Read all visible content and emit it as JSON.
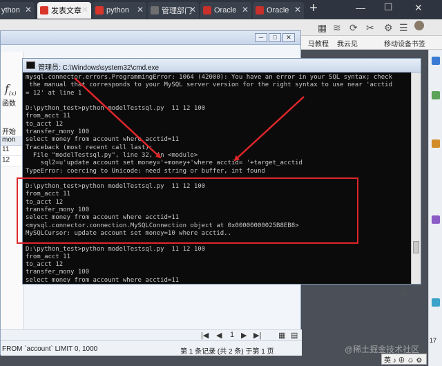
{
  "browser": {
    "tabs": [
      {
        "label": "ython",
        "icon_color": "#e7e7e7"
      },
      {
        "label": "发表文章",
        "icon_color": "#d9352b"
      },
      {
        "label": "python",
        "icon_color": "#d9352b"
      },
      {
        "label": "管理部门",
        "icon_color": "#6f6f6f"
      },
      {
        "label": "Oracle",
        "icon_color": "#c7302b"
      },
      {
        "label": "Oracle",
        "icon_color": "#c7302b"
      }
    ],
    "new_tab": "+",
    "window_controls": {
      "minimize": "—",
      "maximize": "☐",
      "close": "✕"
    },
    "bookmarks": [
      "马教程",
      "我云见",
      "移动设备书签"
    ]
  },
  "navicat": {
    "function_label": "函数",
    "begin_transaction": "开始",
    "column_header": "mon",
    "rows": [
      "11",
      "12"
    ],
    "sql_footer": "FROM `account` LIMIT 0, 1000",
    "record_info": "第 1 条记录 (共 2 条) 于第 1 页",
    "page_number": "1",
    "pager": {
      "first": "|◀",
      "prev": "◀",
      "next": "▶",
      "last": "▶|"
    }
  },
  "cmd": {
    "title": "管理员: C:\\Windows\\system32\\cmd.exe",
    "lines": [
      "mysql.connector.errors.ProgrammingError: 1064 (42000): You have an error in your SQL syntax; check",
      " the manual that corresponds to your MySQL server version for the right syntax to use near 'acctid",
      "= 12' at line 1",
      "",
      "D:\\python_test>python modelTestsql.py  11 12 100",
      "from_acct 11",
      "to_acct 12",
      "transfer_mony 100",
      "select money from account where acctid=11",
      "Traceback (most recent call last):",
      "  File \"modelTestsql.py\", line 32, in <module>",
      "    sql2=u'update account set money='+money+'where acctid= '+target_acctid",
      "TypeError: coercing to Unicode: need string or buffer, int found",
      "",
      "D:\\python_test>python modelTestsql.py  11 12 100",
      "from_acct 11",
      "to_acct 12",
      "transfer_mony 100",
      "select money from account where acctid=11",
      "<mysql.connector.connection.MySQLConnection object at 0x00000000025B8EB8>",
      "MySQLCursor: update account set money=10 where acctid..",
      "",
      "D:\\python_test>python modelTestsql.py  11 12 100",
      "from_acct 11",
      "to_acct 12",
      "transfer_mony 100",
      "select money from account where acctid=11"
    ]
  },
  "taskbar": {
    "clock": "17",
    "ime": "英 ♪ ⊕ ☺ ⚙"
  },
  "watermark": "@稀土掘金技术社区",
  "colors": {
    "highlight": "#e0262a",
    "cmd_bg": "#0b0b0b",
    "cmd_text": "#c8c8c8"
  }
}
